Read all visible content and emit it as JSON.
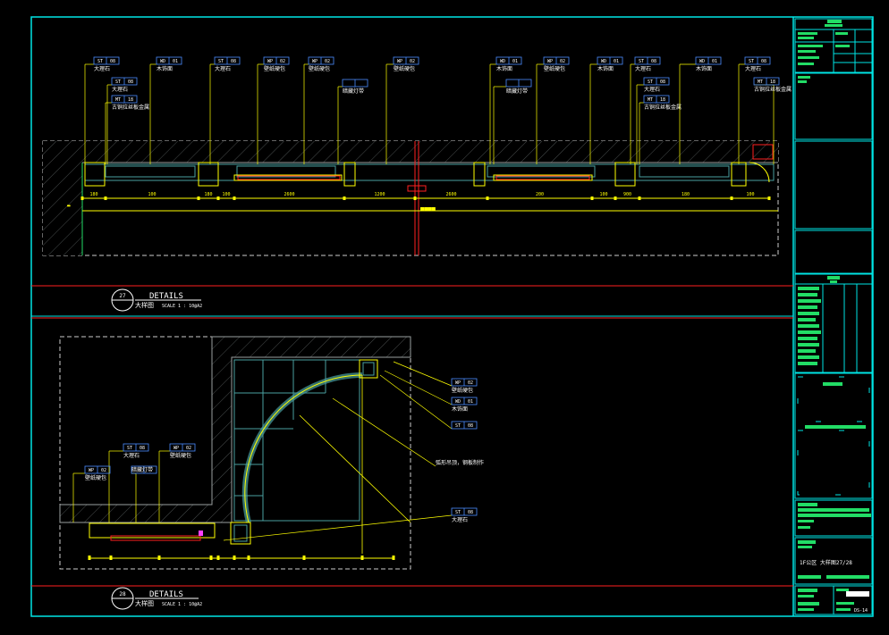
{
  "colors": {
    "frame": "#00e5e5",
    "line": "#ffff00",
    "wall": "#9aa0a0",
    "red": "#ff2020",
    "green": "#22dd66",
    "text": "#ffffff",
    "magenta": "#ff40ff",
    "blue": "#4a8cff"
  },
  "detail_top": {
    "num": "27",
    "title": "DETAILS",
    "name": "大样图",
    "scale": "SCALE 1 : 10@A2"
  },
  "detail_bottom": {
    "num": "28",
    "title": "DETAILS",
    "name": "大样图",
    "scale": "SCALE 1 : 10@A2"
  },
  "top_labels": [
    {
      "code": "ST",
      "num": "08",
      "text": "大理石"
    },
    {
      "code": "ST",
      "num": "08",
      "text": "大理石"
    },
    {
      "code": "MT",
      "num": "18",
      "text": "古铜拉丝板金属"
    },
    {
      "code": "WD",
      "num": "01",
      "text": "木饰面"
    },
    {
      "code": "ST",
      "num": "08",
      "text": "大理石"
    },
    {
      "code": "WP",
      "num": "02",
      "text": "壁纸硬包"
    },
    {
      "code": "WP",
      "num": "02",
      "text": "壁纸硬包"
    },
    {
      "code": "",
      "num": "",
      "text": "暗藏灯带"
    },
    {
      "code": "WP",
      "num": "02",
      "text": "壁纸硬包"
    },
    {
      "code": "WD",
      "num": "01",
      "text": "木饰面"
    },
    {
      "code": "",
      "num": "",
      "text": "暗藏灯带"
    },
    {
      "code": "WP",
      "num": "02",
      "text": "壁纸硬包"
    },
    {
      "code": "WD",
      "num": "01",
      "text": "木饰面"
    },
    {
      "code": "ST",
      "num": "08",
      "text": "大理石"
    },
    {
      "code": "ST",
      "num": "08",
      "text": "大理石"
    },
    {
      "code": "MT",
      "num": "18",
      "text": "古铜拉丝板金属"
    },
    {
      "code": "WD",
      "num": "01",
      "text": "木饰面"
    },
    {
      "code": "ST",
      "num": "08",
      "text": "大理石"
    },
    {
      "code": "MT",
      "num": "18",
      "text": "古铜拉丝板金属"
    }
  ],
  "top_dims": [
    "180",
    "100",
    "180",
    "100",
    "2600",
    "1200",
    "2600",
    "200",
    "100",
    "900",
    "180",
    "100"
  ],
  "bottom_labels": [
    {
      "code": "WP",
      "num": "02",
      "text": "壁纸硬包"
    },
    {
      "code": "WD",
      "num": "01",
      "text": "木饰面"
    },
    {
      "code": "ST",
      "num": "08",
      "text": ""
    },
    {
      "code": "",
      "num": "",
      "text": "弧形吊顶，钢板制作"
    },
    {
      "code": "ST",
      "num": "08",
      "text": "大理石"
    },
    {
      "code": "ST",
      "num": "08",
      "text": "大理石"
    },
    {
      "code": "WP",
      "num": "02",
      "text": "壁纸硬包"
    },
    {
      "code": "WP",
      "num": "02",
      "text": "壁纸硬包"
    },
    {
      "code": "",
      "num": "",
      "text": "暗藏灯带"
    }
  ],
  "title_block": {
    "drawing_title": "1F公区 大样图27/28",
    "sheet_no": "DS-14"
  }
}
